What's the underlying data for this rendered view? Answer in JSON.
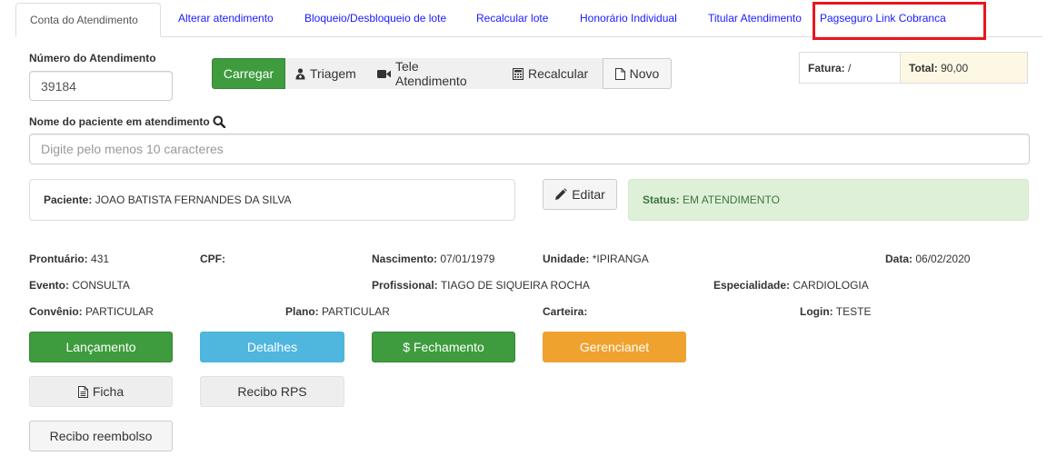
{
  "tabs": [
    {
      "label": "Conta do Atendimento"
    },
    {
      "label": "Alterar atendimento"
    },
    {
      "label": "Bloqueio/Desbloqueio de lote"
    },
    {
      "label": "Recalcular lote"
    },
    {
      "label": "Honorário Individual"
    },
    {
      "label": "Titular Atendimento"
    },
    {
      "label": "Pagseguro Link Cobranca"
    }
  ],
  "atendimento": {
    "label": "Número do Atendimento",
    "value": "39184"
  },
  "toolbar": {
    "carregar": "Carregar",
    "triagem": "Triagem",
    "tele": "Tele Atendimento",
    "recalcular": "Recalcular",
    "novo": "Novo"
  },
  "fatura": {
    "label": "Fatura:",
    "value": "/",
    "total_label": "Total:",
    "total_value": "90,00"
  },
  "paciente_search": {
    "label": "Nome do paciente em atendimento",
    "placeholder": "Digite pelo menos 10 caracteres"
  },
  "paciente": {
    "label": "Paciente:",
    "value": "JOAO BATISTA FERNANDES DA SILVA"
  },
  "editar": "Editar",
  "status": {
    "label": "Status:",
    "value": "EM ATENDIMENTO"
  },
  "info": {
    "prontuario": {
      "label": "Prontuário:",
      "value": "431"
    },
    "cpf": {
      "label": "CPF:",
      "value": ""
    },
    "nascimento": {
      "label": "Nascimento:",
      "value": "07/01/1979"
    },
    "unidade": {
      "label": "Unidade:",
      "value": "*IPIRANGA"
    },
    "data": {
      "label": "Data:",
      "value": "06/02/2020"
    },
    "evento": {
      "label": "Evento:",
      "value": "CONSULTA"
    },
    "profissional": {
      "label": "Profissional:",
      "value": "TIAGO DE SIQUEIRA ROCHA"
    },
    "especialidade": {
      "label": "Especialidade:",
      "value": "CARDIOLOGIA"
    },
    "convenio": {
      "label": "Convênio:",
      "value": "PARTICULAR"
    },
    "plano": {
      "label": "Plano:",
      "value": "PARTICULAR"
    },
    "carteira": {
      "label": "Carteira:",
      "value": ""
    },
    "login": {
      "label": "Login:",
      "value": "TESTE"
    }
  },
  "actions": {
    "lancamento": "Lançamento",
    "detalhes": "Detalhes",
    "fechamento": "$ Fechamento",
    "gerencianet": "Gerencianet",
    "ficha": "Ficha",
    "recibo_rps": "Recibo RPS",
    "recibo_reembolso": "Recibo reembolso"
  },
  "colors": {
    "success": "#3e9c3e",
    "info": "#4fb6de",
    "warning": "#f0a22e",
    "tab_link": "#1a1aff",
    "highlight": "#e8161e",
    "status_bg": "#dff0d8",
    "total_bg": "#fcf8e3"
  },
  "icons": [
    "search-icon",
    "user-md-icon",
    "video-camera-icon",
    "calculator-icon",
    "file-icon",
    "pencil-icon",
    "file-text-icon"
  ]
}
